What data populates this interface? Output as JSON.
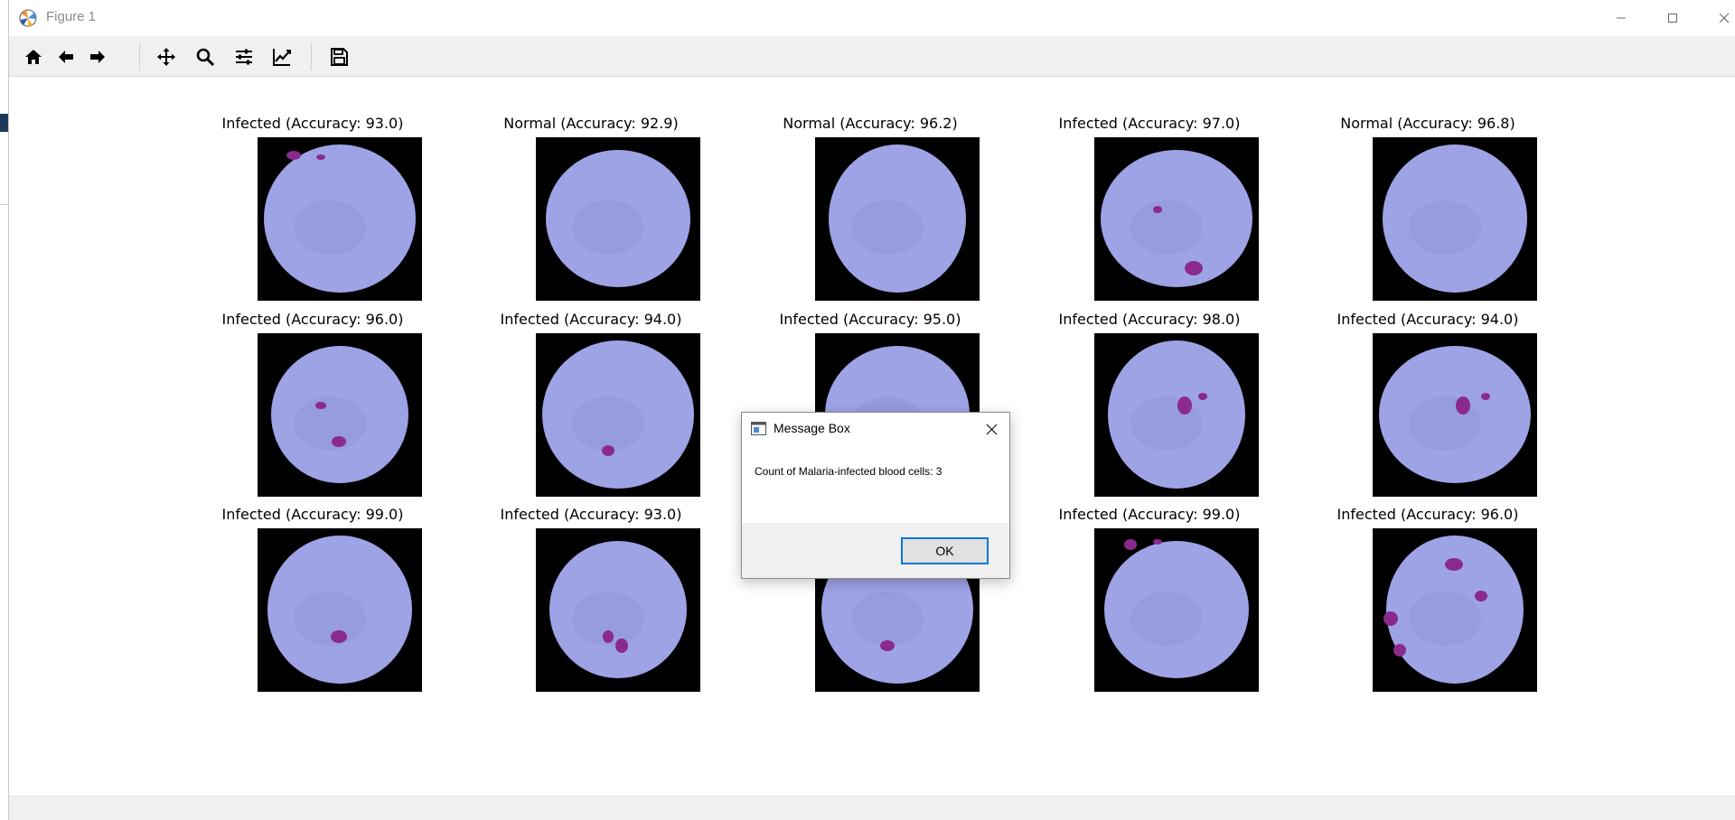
{
  "window": {
    "title": "Figure 1"
  },
  "toolbar": {
    "tools": [
      "home-icon",
      "back-arrow-icon",
      "forward-arrow-icon",
      "pan-icon",
      "zoom-icon",
      "configure-subplots-icon",
      "edit-axis-icon",
      "save-icon"
    ]
  },
  "figure": {
    "rows": [
      [
        {
          "label": "Infected (Accuracy: 93.0)",
          "kind": "infected"
        },
        {
          "label": "Normal (Accuracy: 92.9)",
          "kind": "normal"
        },
        {
          "label": "Normal (Accuracy: 96.2)",
          "kind": "normal"
        },
        {
          "label": "Infected (Accuracy: 97.0)",
          "kind": "infected"
        },
        {
          "label": "Normal (Accuracy: 96.8)",
          "kind": "normal"
        }
      ],
      [
        {
          "label": "Infected (Accuracy: 96.0)",
          "kind": "infected"
        },
        {
          "label": "Infected (Accuracy: 94.0)",
          "kind": "infected"
        },
        {
          "label": "Infected (Accuracy: 95.0)",
          "kind": "infected"
        },
        {
          "label": "Infected (Accuracy: 98.0)",
          "kind": "infected"
        },
        {
          "label": "Infected (Accuracy: 94.0)",
          "kind": "infected"
        }
      ],
      [
        {
          "label": "Infected (Accuracy: 99.0)",
          "kind": "infected"
        },
        {
          "label": "Infected (Accuracy: 93.0)",
          "kind": "infected"
        },
        {
          "label": "",
          "kind": "infected"
        },
        {
          "label": "Infected (Accuracy: 99.0)",
          "kind": "infected"
        },
        {
          "label": "Infected (Accuracy: 96.0)",
          "kind": "infected"
        }
      ]
    ]
  },
  "messagebox": {
    "title": "Message Box",
    "text": "Count of Malaria-infected blood cells: 3",
    "ok_label": "OK"
  },
  "colors": {
    "cell": "#9ea3e6",
    "cell_shade": "#8f93d8",
    "stain": "#8a2a8c",
    "accent": "#0078d7"
  }
}
